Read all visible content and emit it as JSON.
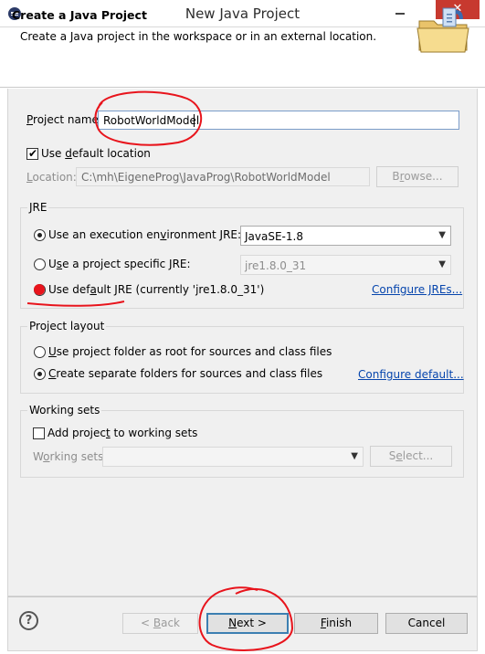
{
  "window": {
    "title": "New Java Project",
    "close_glyph": "✕"
  },
  "header": {
    "title": "Create a Java Project",
    "description": "Create a Java project in the workspace or in an external location."
  },
  "project_name": {
    "label_u": "P",
    "label_rest": "roject name:",
    "value": "RobotWorldModel"
  },
  "default_location": {
    "checked": true,
    "label_pre": "Use ",
    "label_u": "d",
    "label_post": "efault location"
  },
  "location": {
    "label_u": "L",
    "label_rest": "ocation:",
    "value": "C:\\mh\\EigeneProg\\JavaProg\\RobotWorldModel",
    "browse_u": "r",
    "browse_pre": "B",
    "browse_post": "owse..."
  },
  "jre": {
    "title": "JRE",
    "option1_pre": "Use an execution en",
    "option1_u": "v",
    "option1_post": "ironment JRE:",
    "option1_value": "JavaSE-1.8",
    "option2_pre": "U",
    "option2_u": "s",
    "option2_post": "e a project specific JRE:",
    "option2_value": "jre1.8.0_31",
    "option3_pre": "Use def",
    "option3_u": "a",
    "option3_post": "ult JRE (currently 'jre1.8.0_31')",
    "configure_link": "Configure JREs...",
    "selected_option": 3
  },
  "project_layout": {
    "title": "Project layout",
    "option1_u": "U",
    "option1_rest": "se project folder as root for sources and class files",
    "option2_u": "C",
    "option2_rest": "reate separate folders for sources and class files",
    "configure_link": "Configure default...",
    "selected_option": 2
  },
  "working_sets": {
    "title": "Working sets",
    "add_pre": "Add projec",
    "add_u": "t",
    "add_post": " to working sets",
    "sets_u": "o",
    "sets_pre": "W",
    "sets_post": "rking sets:",
    "select_pre": "S",
    "select_u": "e",
    "select_post": "lect..."
  },
  "footer": {
    "help_glyph": "?",
    "back_pre": "< ",
    "back_u": "B",
    "back_post": "ack",
    "next_u": "N",
    "next_post": "ext >",
    "finish_u": "F",
    "finish_post": "inish",
    "cancel": "Cancel"
  },
  "colors": {
    "annotation_red": "#e8141c",
    "link_blue": "#0645ad",
    "close_red": "#c7392f"
  }
}
